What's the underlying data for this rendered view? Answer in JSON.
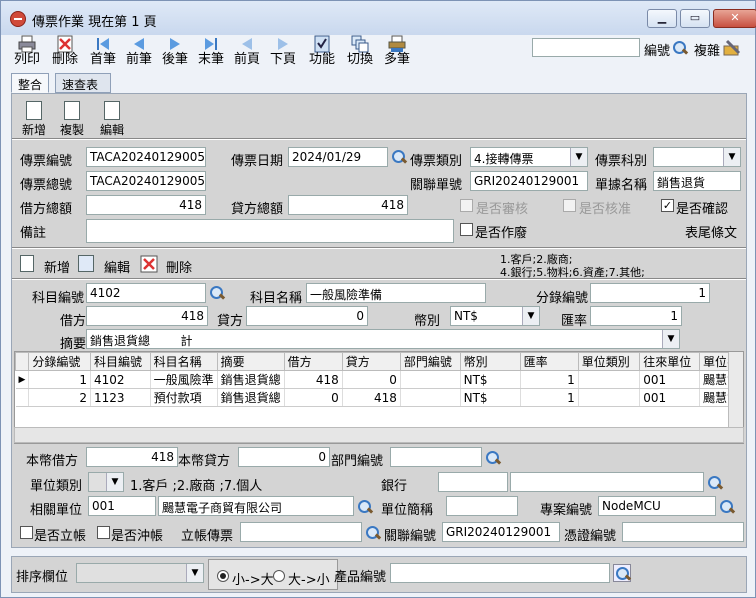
{
  "window": {
    "title": "傳票作業  現在第 1 頁"
  },
  "toolbar": {
    "print": "列印",
    "delete": "刪除",
    "first": "首筆",
    "prev": "前筆",
    "next": "後筆",
    "last": "末筆",
    "prev_page": "前頁",
    "next_page": "下頁",
    "functions": "功能",
    "switch": "切換",
    "multi": "多筆",
    "search_value": "",
    "edit_no": "編號",
    "copy_to": "複雜"
  },
  "tabs": [
    "整合",
    "速查表"
  ],
  "header_actions": {
    "add": "新增",
    "copy": "複製",
    "edit": "編輯"
  },
  "header": {
    "voucher_no_label": "傳票編號",
    "voucher_no": "TACA20240129005",
    "voucher_date_label": "傳票日期",
    "voucher_date": "2024/01/29",
    "voucher_type_label": "傳票類別",
    "voucher_type": "4.接轉傳票",
    "voucher_subject_label": "傳票科別",
    "voucher_subject": "",
    "voucher_total_no_label": "傳票總號",
    "voucher_total_no": "TACA20240129005",
    "related_no_label": "關聯單號",
    "related_no": "GRI20240129001",
    "doc_name_label": "單據名稱",
    "doc_name": "銷售退貨",
    "debit_total_label": "借方總額",
    "debit_total": "418",
    "credit_total_label": "貸方總額",
    "credit_total": "418",
    "reviewed_label": "是否審核",
    "approved_label": "是否核准",
    "confirmed_label": "是否確認",
    "note_label": "備註",
    "note": "",
    "voided_label": "是否作廢",
    "footer_text_label": "表尾條文"
  },
  "detail_actions": {
    "add": "新增",
    "edit": "編輯",
    "delete": "刪除",
    "hint1": "1.客戶;2.廠商;",
    "hint2": "4.銀行;5.物料;6.資產;7.其他;"
  },
  "detail": {
    "account_no_label": "科目編號",
    "account_no": "4102",
    "account_name_label": "科目名稱",
    "account_name": "一般風險準備",
    "entry_no_label": "分錄編號",
    "entry_no": "1",
    "debit_label": "借方",
    "debit": "418",
    "credit_label": "貸方",
    "credit": "0",
    "currency_label": "幣別",
    "currency": "NT$",
    "rate_label": "匯率",
    "rate": "1",
    "summary_label": "摘要",
    "summary": "銷售退貨總        計"
  },
  "grid": {
    "columns": [
      "分錄編號",
      "科目編號",
      "科目名稱",
      "摘要",
      "借方",
      "貸方",
      "部門編號",
      "幣別",
      "匯率",
      "單位類別",
      "往來單位",
      "單位名"
    ],
    "rows": [
      [
        "1",
        "4102",
        "一般風險準",
        "銷售退貨總",
        "418",
        "0",
        "",
        "NT$",
        "1",
        "",
        "001",
        "颺慧電"
      ],
      [
        "2",
        "1123",
        "預付款項",
        "銷售退貨總",
        "0",
        "418",
        "",
        "NT$",
        "1",
        "",
        "001",
        "颺慧電"
      ]
    ]
  },
  "lower": {
    "local_debit_label": "本幣借方",
    "local_debit": "418",
    "local_credit_label": "本幣貸方",
    "local_credit": "0",
    "dept_no_label": "部門編號",
    "dept_no": "",
    "unit_type_label": "單位類別",
    "unit_type": "",
    "unit_type_hint": "1.客戶 ;2.廠商 ;7.個人",
    "bank_label": "銀行",
    "bank_code": "",
    "bank_name": "",
    "related_unit_label": "相關單位",
    "related_unit_code": "001",
    "related_unit_name": "颺慧電子商貿有限公司",
    "unit_short_label": "單位簡稱",
    "unit_short": "",
    "project_no_label": "專案編號",
    "project_no": "NodeMCU",
    "is_offset_label": "是否立帳",
    "is_reverse_label": "是否沖帳",
    "offset_voucher_label": "立帳傳票",
    "offset_voucher": "",
    "related_no_label": "關聯編號",
    "related_no": "GRI20240129001",
    "proof_no_label": "憑證編號",
    "proof_no": ""
  },
  "bottom": {
    "sort_label": "排序欄位",
    "sort_value": "",
    "asc": "小->大",
    "desc": "大->小",
    "product_no_label": "產品編號",
    "product_no": ""
  }
}
